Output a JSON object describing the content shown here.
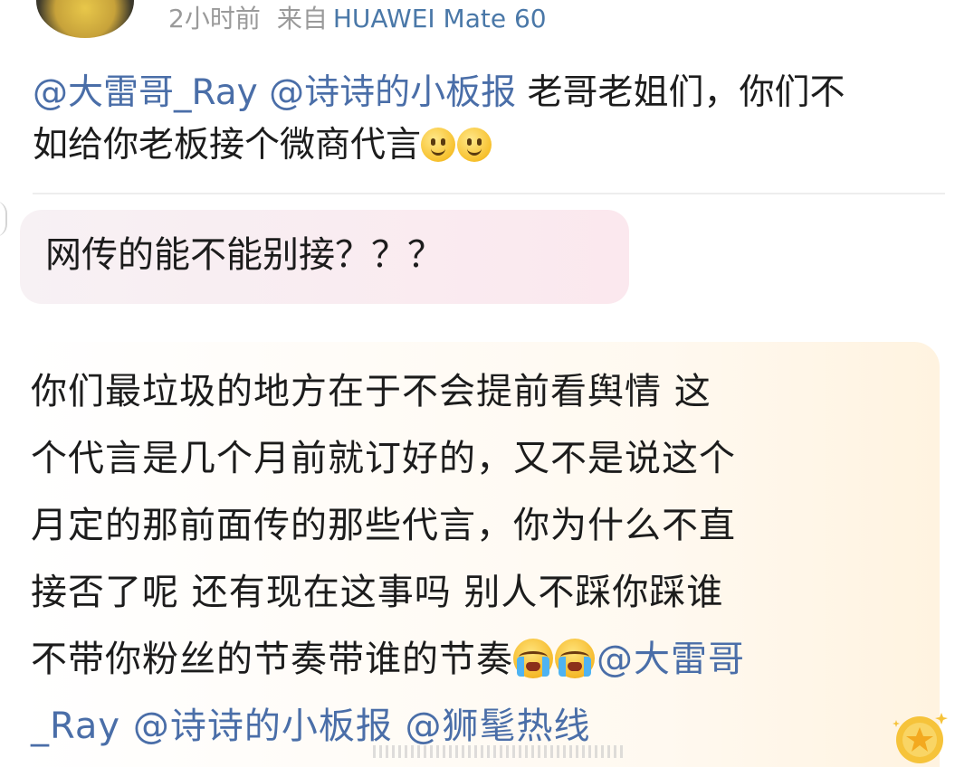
{
  "header": {
    "time": "2小时前",
    "source_prefix": "来自",
    "device": "HUAWEI Mate 60"
  },
  "comment1": {
    "mention1": "@大雷哥_Ray",
    "mention2": "@诗诗的小板报",
    "text_line1": " 老哥老姐们，你们不",
    "text_line2": "如给你老板接个微商代言",
    "emojis": [
      "smile-emoji",
      "smile-emoji"
    ]
  },
  "bubble1": {
    "text": "网传的能不能别接？？？"
  },
  "bubble2": {
    "line1": "你们最垃圾的地方在于不会提前看舆情 这",
    "line2": "个代言是几个月前就订好的，又不是说这个",
    "line3": "月定的那前面传的那些代言，你为什么不直",
    "line4": "接否了呢 还有现在这事吗 别人不踩你踩谁",
    "line5_text": "不带你粉丝的节奏带谁的节奏",
    "line5_mention": "@大雷哥",
    "line6_mention1": "_Ray",
    "line6_mention2": "@诗诗的小板报",
    "line6_mention3": "@狮髦热线",
    "emojis": [
      "crying-emoji",
      "crying-emoji"
    ]
  },
  "colors": {
    "mention": "#4a6ea8",
    "meta": "#9a9a9a",
    "text": "#1c1c1c",
    "bubble1_bg": "#fbe8ee",
    "bubble2_bg": "#fff3e0"
  }
}
